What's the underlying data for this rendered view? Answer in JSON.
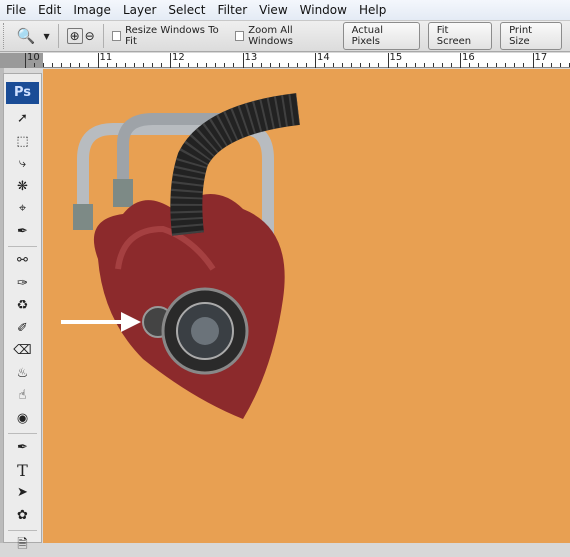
{
  "menu": [
    "File",
    "Edit",
    "Image",
    "Layer",
    "Select",
    "Filter",
    "View",
    "Window",
    "Help"
  ],
  "options": {
    "resize_windows": "Resize Windows To Fit",
    "zoom_all": "Zoom All Windows",
    "actual_pixels": "Actual Pixels",
    "fit_screen": "Fit Screen",
    "print_size": "Print Size"
  },
  "ruler": [
    "10",
    "11",
    "12",
    "13",
    "14",
    "15",
    "16",
    "17"
  ],
  "tools": {
    "logo": "Ps",
    "type_tool": "T"
  },
  "colors": {
    "canvas": "#e8a052",
    "ps_logo": "#1a4c96"
  }
}
